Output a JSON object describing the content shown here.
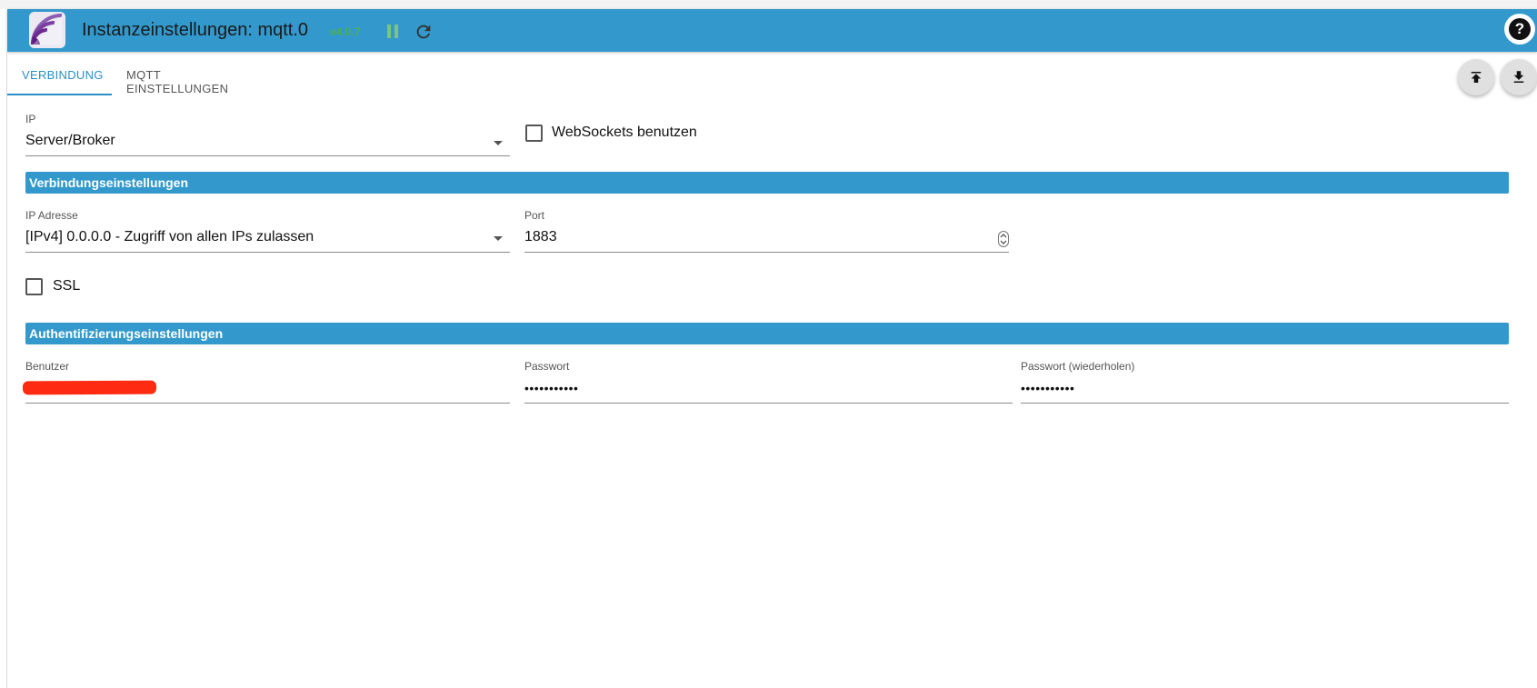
{
  "header": {
    "title": "Instanzeinstellungen: mqtt.0",
    "version": "v4.0.7",
    "accent_color": "#3399cc",
    "version_color": "#4caf50"
  },
  "tabs": [
    {
      "label": "VERBINDUNG",
      "active": true
    },
    {
      "label": "MQTT EINSTELLUNGEN",
      "active": false
    }
  ],
  "actions": {
    "upload_icon": "upload-icon",
    "download_icon": "download-icon",
    "help_icon": "help-icon"
  },
  "connection": {
    "ip_label": "IP",
    "ip_value": "Server/Broker",
    "websockets_label": "WebSockets benutzen",
    "websockets_checked": false
  },
  "connection_settings": {
    "section_title": "Verbindungseinstellungen",
    "ip_address_label": "IP Adresse",
    "ip_address_value": "[IPv4] 0.0.0.0 - Zugriff von allen IPs zulassen",
    "port_label": "Port",
    "port_value": "1883",
    "ssl_label": "SSL",
    "ssl_checked": false
  },
  "auth_settings": {
    "section_title": "Authentifizierungseinstellungen",
    "user_label": "Benutzer",
    "password_label": "Passwort",
    "password_value": "•••••••••••",
    "password_repeat_label": "Passwort (wiederholen)",
    "password_repeat_value": "•••••••••••"
  }
}
